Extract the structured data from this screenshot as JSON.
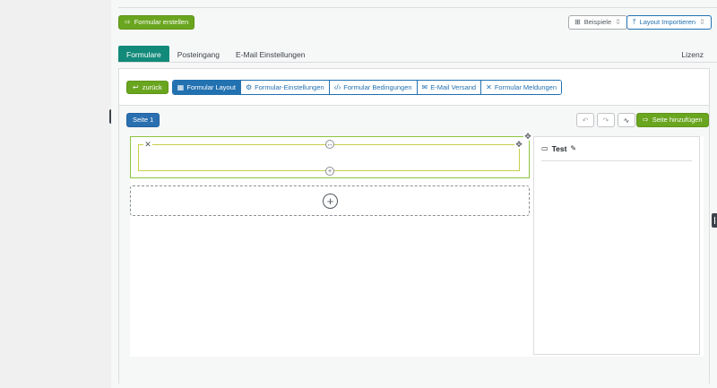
{
  "header": {
    "create_form_label": "Formular erstellen",
    "examples_label": "Beispiele",
    "import_layout_label": "Layout Importieren"
  },
  "tabs": [
    {
      "label": "Formulare",
      "active": true
    },
    {
      "label": "Posteingang"
    },
    {
      "label": "E-Mail Einstellungen"
    }
  ],
  "license_label": "Lizenz",
  "toolbar": {
    "back_label": "zurück",
    "items": [
      {
        "label": "Formular Layout",
        "icon": "grid-icon",
        "active": true
      },
      {
        "label": "Formular-Einstellungen",
        "icon": "gear-icon"
      },
      {
        "label": "Formular Bedingungen",
        "icon": "code-icon"
      },
      {
        "label": "E-Mail Versand",
        "icon": "email-icon"
      },
      {
        "label": "Formular Meldungen",
        "icon": "tools-icon"
      }
    ]
  },
  "editor": {
    "page_label": "Seite 1",
    "add_page_label": "Seite hinzufügen"
  },
  "sidebar": {
    "title": "Test"
  },
  "colors": {
    "green": "#6aa51f",
    "teal": "#128a7a",
    "blue": "#2271b1"
  }
}
